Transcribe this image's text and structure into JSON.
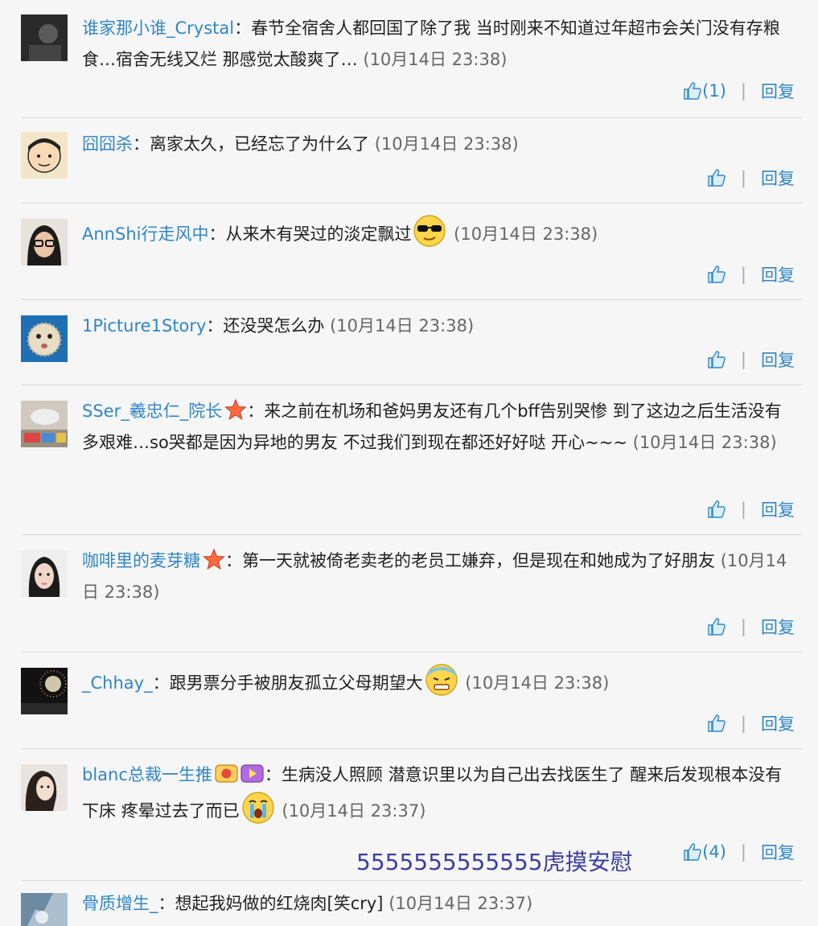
{
  "comments": [
    {
      "user": "谁家那小谁_Crystal",
      "text": "春节全宿舍人都回国了除了我 当时刚来不知道过年超市会关门没有存粮食…宿舍无线又烂 那感觉太酸爽了…",
      "time": "(10月14日 23:38)",
      "likes": "(1)",
      "reply": "回复"
    },
    {
      "user": "囧囧杀",
      "text": "离家太久，已经忘了为什么了",
      "time": "(10月14日 23:38)",
      "likes": "",
      "reply": "回复"
    },
    {
      "user": "AnnShi行走风中",
      "text": "从来木有哭过的淡定飘过",
      "time": "(10月14日 23:38)",
      "likes": "",
      "reply": "回复",
      "emoji": "cool-sunglasses-emoji"
    },
    {
      "user": "1Picture1Story",
      "text": "还没哭怎么办",
      "time": "(10月14日 23:38)",
      "likes": "",
      "reply": "回复"
    },
    {
      "user": "SSer_羲忠仁_院长",
      "text": "来之前在机场和爸妈男友还有几个bff告别哭惨 到了这边之后生活没有多艰难…so哭都是因为异地的男友 不过我们到现在都还好好哒 开心~~~",
      "time": "(10月14日 23:38)",
      "likes": "",
      "reply": "回复",
      "badge": "star-badge-icon"
    },
    {
      "user": "咖啡里的麦芽糖",
      "text": "第一天就被倚老卖老的老员工嫌弃，但是现在和她成为了好朋友",
      "time": "(10月14日 23:38)",
      "likes": "",
      "reply": "回复",
      "badge": "star-badge-icon"
    },
    {
      "user": "_Chhay_",
      "text": "跟男票分手被朋友孤立父母期望大",
      "time": "(10月14日 23:38)",
      "likes": "",
      "reply": "回复",
      "emoji": "sweat-emoji"
    },
    {
      "user": "blanc总裁一生推",
      "text": "生病没人照顾 潜意识里以为自己出去找医生了 醒来后发现根本没有下床 疼晕过去了而已",
      "time": "(10月14日 23:37)",
      "likes": "(4)",
      "reply": "回复",
      "badge": "vip-badges-icon",
      "emoji": "crying-emoji"
    },
    {
      "user": "骨质增生_",
      "text": "想起我妈做的红烧肉[笑cry]",
      "time": "(10月14日 23:37)",
      "likes": "",
      "reply": "回复"
    }
  ],
  "overlay_caption": "5555555555555虎摸安慰",
  "colors": {
    "link": "#2f86c8",
    "text": "#222222",
    "time": "#666666",
    "background": "#f6f6f6",
    "caption": "#3a3fa0"
  }
}
